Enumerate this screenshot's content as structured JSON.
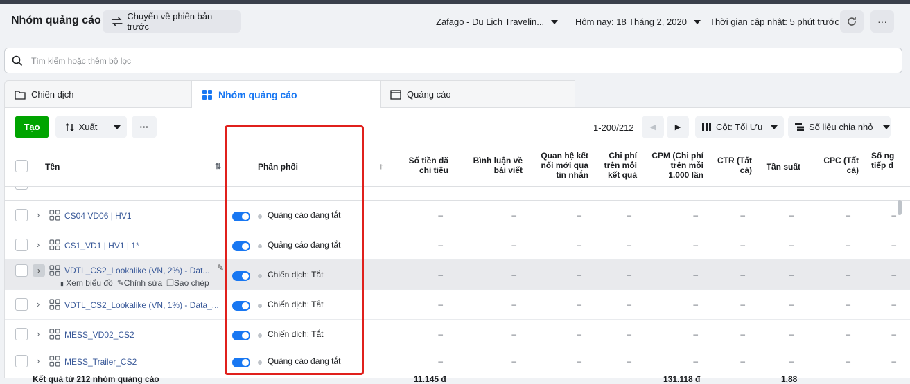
{
  "header": {
    "title": "Nhóm quảng cáo",
    "revert_label": "Chuyển về phiên bản trước",
    "account": "Zafago - Du Lịch Travelin...",
    "date_range": "Hôm nay: 18 Tháng 2, 2020",
    "updated": "Thời gian cập nhật: 5 phút trước",
    "refresh_icon": "refresh-icon",
    "more_icon": "more-icon"
  },
  "search": {
    "placeholder": "Tìm kiếm hoặc thêm bộ lọc"
  },
  "tabs": [
    {
      "label": "Chiến dịch",
      "icon": "folder-icon"
    },
    {
      "label": "Nhóm quảng cáo",
      "icon": "grid-icon",
      "active": true
    },
    {
      "label": "Quảng cáo",
      "icon": "ad-icon"
    }
  ],
  "toolbar": {
    "create_label": "Tạo",
    "export_label": "Xuất",
    "more_label": "···",
    "pager": "1-200/212",
    "columns_label": "Cột: Tối Ưu",
    "breakdown_label": "Số liệu chia nhỏ"
  },
  "columns": {
    "name": "Tên",
    "delivery": "Phân phối",
    "spent": "Số tiền đã chi tiêu",
    "comments": "Bình luận về bài viết",
    "messaging": "Quan hệ kết nối mới qua tin nhắn",
    "cost_per_result": "Chi phí trên mỗi kết quả",
    "cpm": "CPM (Chi phí trên mỗi 1.000 lần",
    "ctr": "CTR (Tất cả)",
    "frequency": "Tần suất",
    "cpc": "CPC (Tất cả)",
    "more": "Số ng tiếp đ"
  },
  "rows": [
    {
      "name": "CS04 VD06 | HV1",
      "status": "Quảng cáo đang tắt"
    },
    {
      "name": "CS1_VD1 | HV1 | 1*",
      "status": "Quảng cáo đang tắt"
    },
    {
      "name": "VDTL_CS2_Lookalike (VN, 2%) - Dat...",
      "status": "Chiến dịch: Tắt"
    },
    {
      "name": "VDTL_CS2_Lookalike (VN, 1%) - Data_...",
      "status": "Chiến dịch: Tắt"
    },
    {
      "name": "MESS_VD02_CS2",
      "status": "Chiến dịch: Tắt"
    },
    {
      "name": "MESS_Trailer_CS2",
      "status": "Quảng cáo đang tắt"
    }
  ],
  "row_actions": {
    "chart": "Xem biểu đồ",
    "edit": "Chỉnh sửa",
    "copy": "Sao chép"
  },
  "dash": "–",
  "footer": {
    "label": "Kết quả từ 212 nhóm quảng cáo",
    "spent": "11.145 đ",
    "cpm": "131.118 đ",
    "frequency": "1,88"
  },
  "colors": {
    "accent": "#1877f2",
    "create": "#00a400",
    "highlight": "#e0201c"
  }
}
